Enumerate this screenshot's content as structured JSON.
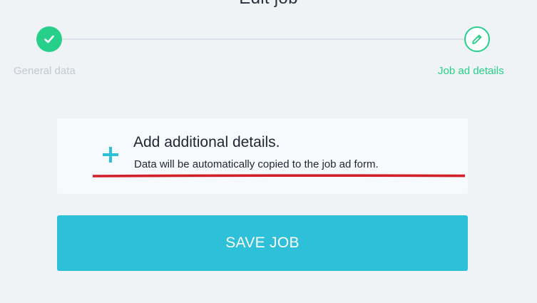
{
  "header": {
    "title": "Edit job"
  },
  "stepper": {
    "steps": [
      {
        "label": "General data",
        "state": "completed",
        "icon": "check-icon"
      },
      {
        "label": "Job ad details",
        "state": "active",
        "icon": "pencil-icon"
      }
    ]
  },
  "details_card": {
    "icon": "plus-icon",
    "title": "Add additional details.",
    "subtitle": "Data will be automatically copied to the job ad form."
  },
  "actions": {
    "save_label": "SAVE JOB"
  },
  "colors": {
    "accent_green": "#26d08a",
    "button_teal": "#2ec0d8",
    "plus_teal": "#2ec0d8",
    "annotation_red": "#d2202a",
    "inactive_gray": "#c2c9d2",
    "background": "#f0f3f6"
  }
}
